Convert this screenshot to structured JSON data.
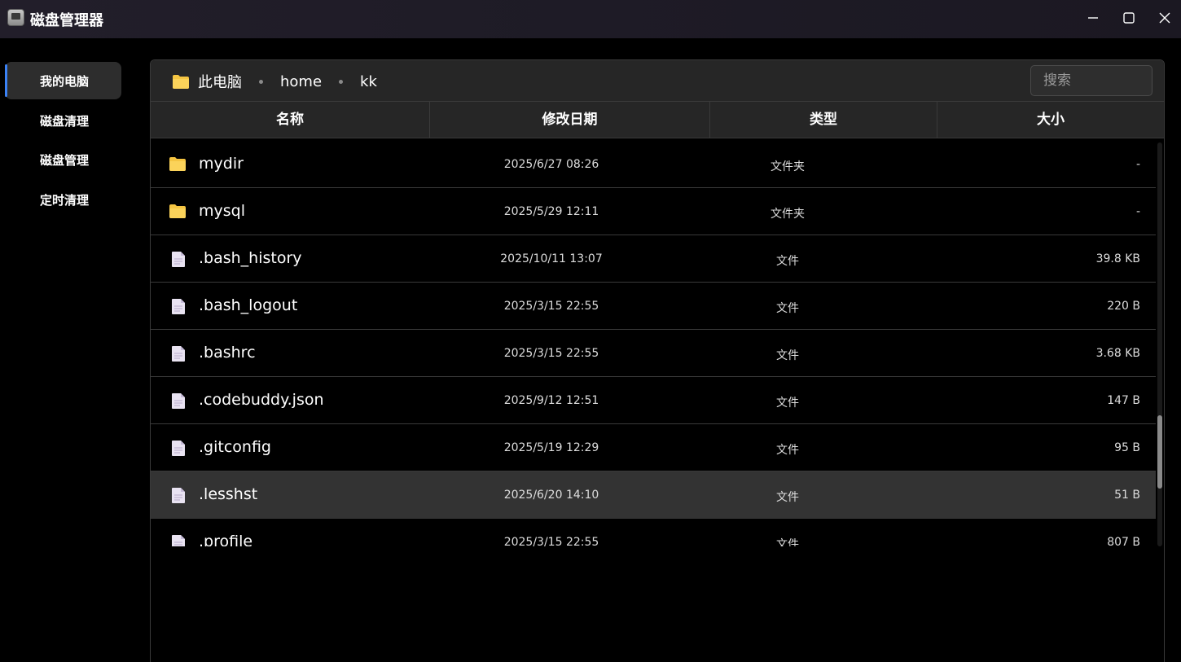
{
  "window": {
    "title": "磁盘管理器",
    "icons": [
      "app-icon",
      "minimize-icon",
      "maximize-icon",
      "close-icon"
    ]
  },
  "sidebar": {
    "items": [
      {
        "label": "我的电脑",
        "active": true
      },
      {
        "label": "磁盘清理",
        "active": false
      },
      {
        "label": "磁盘管理",
        "active": false
      },
      {
        "label": "定时清理",
        "active": false
      }
    ]
  },
  "breadcrumb": {
    "root": "此电脑",
    "parts": [
      "home",
      "kk"
    ]
  },
  "search": {
    "placeholder": "搜索"
  },
  "table": {
    "columns": [
      "名称",
      "修改日期",
      "类型",
      "大小"
    ],
    "rows": [
      {
        "name": "mydir",
        "date": "2025/6/27 08:26",
        "type": "文件夹",
        "size": "-",
        "icon": "folder-icon"
      },
      {
        "name": "mysql",
        "date": "2025/5/29 12:11",
        "type": "文件夹",
        "size": "-",
        "icon": "folder-icon"
      },
      {
        "name": ".bash_history",
        "date": "2025/10/11 13:07",
        "type": "文件",
        "size": "39.8 KB",
        "icon": "file-icon"
      },
      {
        "name": ".bash_logout",
        "date": "2025/3/15 22:55",
        "type": "文件",
        "size": "220 B",
        "icon": "file-icon"
      },
      {
        "name": ".bashrc",
        "date": "2025/3/15 22:55",
        "type": "文件",
        "size": "3.68 KB",
        "icon": "file-icon"
      },
      {
        "name": ".codebuddy.json",
        "date": "2025/9/12 12:51",
        "type": "文件",
        "size": "147 B",
        "icon": "file-icon"
      },
      {
        "name": ".gitconfig",
        "date": "2025/5/19 12:29",
        "type": "文件",
        "size": "95 B",
        "icon": "file-icon"
      },
      {
        "name": ".lesshst",
        "date": "2025/6/20 14:10",
        "type": "文件",
        "size": "51 B",
        "icon": "file-icon",
        "selected": true
      },
      {
        "name": ".profile",
        "date": "2025/3/15 22:55",
        "type": "文件",
        "size": "807 B",
        "icon": "file-icon"
      }
    ]
  },
  "colors": {
    "accent": "#3b82f6",
    "folder": "#f5c542",
    "file": "#d8cde8",
    "selected_row": "#333333"
  }
}
